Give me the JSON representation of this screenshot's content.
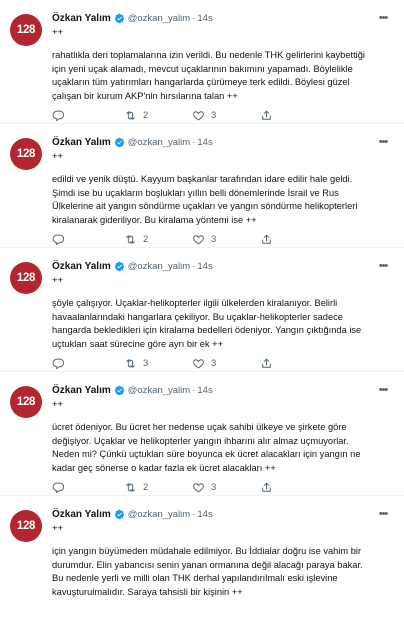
{
  "tweets": [
    {
      "author": "Özkan Yalım",
      "handle": "@ozkan_yalim",
      "time": "14s",
      "plus": "++",
      "lines": [
        "rahatlıkla deri toplamalarına izin verildi. Bu nedenle THK gelirlerini kaybettiği",
        "için yeni uçak alamadı, mevcut uçaklarının bakımını yapamadı. Böylelikle",
        "uçakların tüm yatırımları hangarlarda çürümeye terk edildi. Böylesi güzel",
        "çalışan bir kurum AKP'nin hırsılarına talan ++"
      ],
      "retweets": "2",
      "likes": "3"
    },
    {
      "author": "Özkan Yalım",
      "handle": "@ozkan_yalim",
      "time": "14s",
      "plus": "++",
      "lines": [
        "edildi ve yenik düştü. Kayyum başkanlar tarafından idare edilir hale geldi.",
        "Şimdi ise bu uçakların boşlukları yıllın belli dönemlerinde İsrail ve Rus",
        "Ülkelerine ait yangın söndürme uçakları ve yangın söndürme helikopterleri",
        "kiralanarak gideriliyor. Bu kiralama yöntemi ise ++"
      ],
      "retweets": "2",
      "likes": "3"
    },
    {
      "author": "Özkan Yalım",
      "handle": "@ozkan_yalim",
      "time": "14s",
      "plus": "++",
      "lines": [
        "şöyle çalışıyor. Uçaklar-helikopterler ilgili ülkelerden kiralanıyor. Belirli",
        "havaalanlarındaki  hangarlara çekiliyor. Bu uçaklar-helikopterler sadece",
        "hangarda bekledikleri için kiralama bedelleri ödeniyor. Yangın çıktığında ise",
        "uçtukları saat sürecine göre ayrı bir ek ++"
      ],
      "retweets": "3",
      "likes": "3"
    },
    {
      "author": "Özkan Yalım",
      "handle": "@ozkan_yalim",
      "time": "14s",
      "plus": "++",
      "lines": [
        "ücret ödeniyor. Bu ücret her nedense uçak sahibi ülkeye ve şirkete göre",
        "değişiyor. Uçaklar ve helikopterler yangın ihbarını alır almaz uçmuyorlar.",
        "Neden mi? Çünkü uçtukları süre boyunca ek ücret alacakları için yangın ne",
        "kadar geç sönerse o kadar fazla ek ücret alacakları ++"
      ],
      "retweets": "2",
      "likes": "3"
    },
    {
      "author": "Özkan Yalım",
      "handle": "@ozkan_yalim",
      "time": "14s",
      "plus": "++",
      "lines": [
        "için yangın büyümeden müdahale edilmiyor. Bu İddialar doğru ise vahim bir",
        "durumdur. Elin yabancısı senin yanan ormanına değil alacağı paraya bakar.",
        "Bu nedenle yerli ve milli olan THK derhal yapılandırılmalı eski işlevine",
        "kavuşturulmalıdır. Saraya tahsisli bir kişinin ++"
      ],
      "retweets": "",
      "likes": ""
    }
  ],
  "avatar_text": "128",
  "more_icon": "more-horizontal-icon",
  "colors": {
    "avatar": "#b3262f",
    "verified": "#1d9bf0",
    "muted": "#536471",
    "text": "#0f1419"
  }
}
